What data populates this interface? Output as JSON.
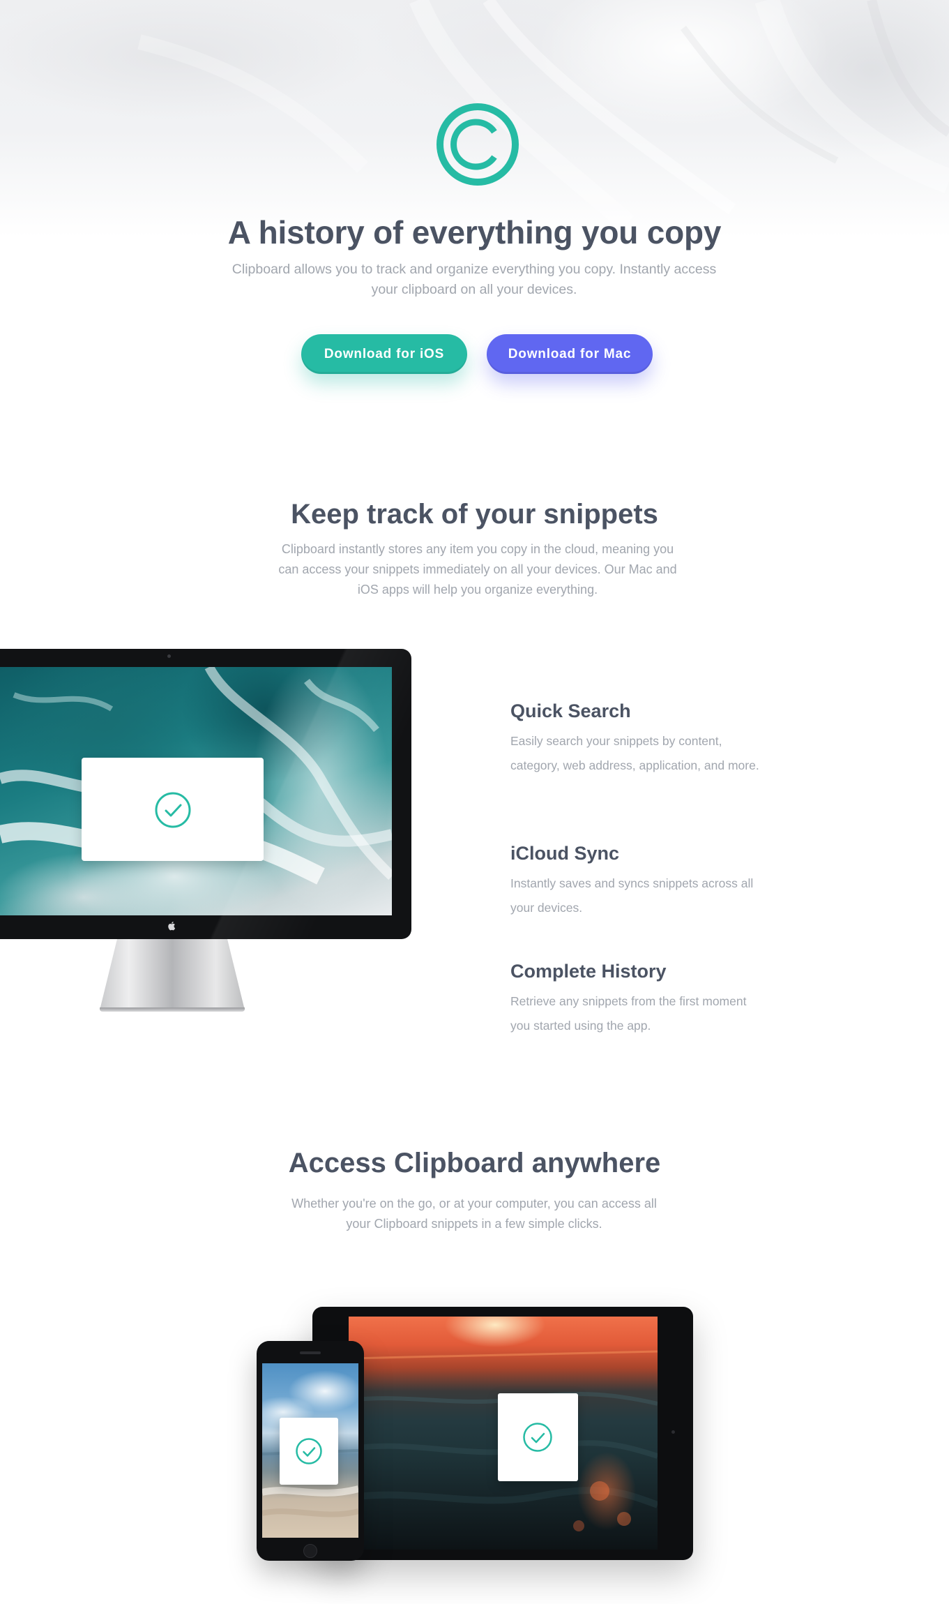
{
  "hero": {
    "logo_icon": "copyright-circle-icon",
    "title": "A history of everything you copy",
    "subtitle": "Clipboard allows you to track and organize everything you copy. Instantly access your clipboard on all your devices.",
    "download_ios_label": "Download for iOS",
    "download_mac_label": "Download for Mac"
  },
  "snippets": {
    "title": "Keep track of your snippets",
    "subtitle": "Clipboard instantly stores any item you copy in the cloud, meaning you can access your snippets immediately on all your devices. Our Mac and iOS apps will help you organize everything.",
    "features": [
      {
        "title": "Quick Search",
        "description": "Easily search your snippets by content, category, web address, application, and more."
      },
      {
        "title": "iCloud Sync",
        "description": "Instantly saves and syncs snippets across all your devices."
      },
      {
        "title": "Complete History",
        "description": "Retrieve any snippets from the first moment you started using the app."
      }
    ]
  },
  "access": {
    "title": "Access Clipboard anywhere",
    "subtitle": "Whether you're on the go, or at your computer, you can access all your Clipboard snippets in a few simple clicks."
  },
  "colors": {
    "accent_teal": "#26bba4",
    "accent_indigo": "#6067f1",
    "heading": "#4b5363",
    "body_text": "#a1a6ae"
  },
  "icons": [
    "copyright-circle-icon",
    "check-circle-icon",
    "apple-icon"
  ]
}
